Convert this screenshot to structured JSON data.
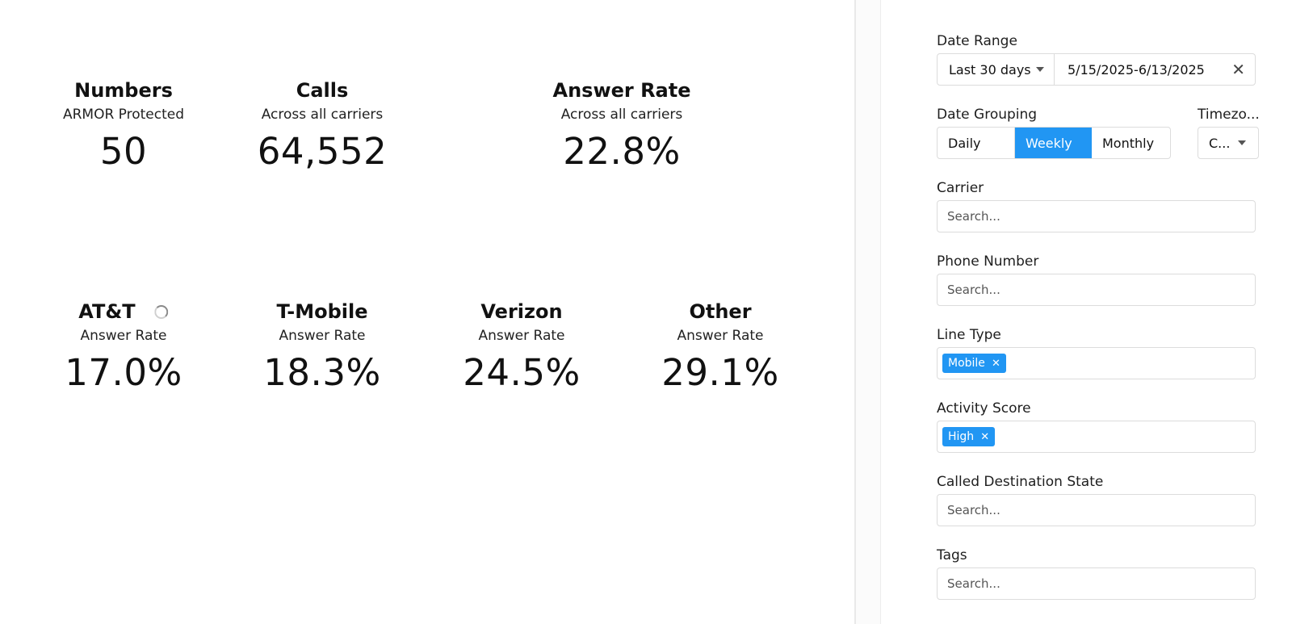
{
  "summary": [
    {
      "title": "Numbers",
      "subtitle": "ARMOR Protected",
      "value": "50"
    },
    {
      "title": "Calls",
      "subtitle": "Across all carriers",
      "value": "64,552"
    },
    {
      "title": "Answer Rate",
      "subtitle": "Across all carriers",
      "value": "22.8%"
    }
  ],
  "carriers": [
    {
      "title": "AT&T",
      "subtitle": "Answer Rate",
      "value": "17.0%",
      "loading": true
    },
    {
      "title": "T-Mobile",
      "subtitle": "Answer Rate",
      "value": "18.3%"
    },
    {
      "title": "Verizon",
      "subtitle": "Answer Rate",
      "value": "24.5%"
    },
    {
      "title": "Other",
      "subtitle": "Answer Rate",
      "value": "29.1%"
    }
  ],
  "filters": {
    "date_range": {
      "label": "Date Range",
      "preset": "Last 30 days",
      "value": "5/15/2025-6/13/2025",
      "clear_icon": "close-icon"
    },
    "date_grouping": {
      "label": "Date Grouping",
      "options": [
        "Daily",
        "Weekly",
        "Monthly"
      ],
      "selected": "Weekly",
      "active_color": "#2196f3"
    },
    "timezone": {
      "label": "Timezo...",
      "value": "C..."
    },
    "carrier": {
      "label": "Carrier",
      "placeholder": "Search..."
    },
    "phone_number": {
      "label": "Phone Number",
      "placeholder": "Search..."
    },
    "line_type": {
      "label": "Line Type",
      "chips": [
        "Mobile"
      ]
    },
    "activity_score": {
      "label": "Activity Score",
      "chips": [
        "High"
      ]
    },
    "called_destination_state": {
      "label": "Called Destination State",
      "placeholder": "Search..."
    },
    "tags": {
      "label": "Tags",
      "placeholder": "Search..."
    }
  }
}
